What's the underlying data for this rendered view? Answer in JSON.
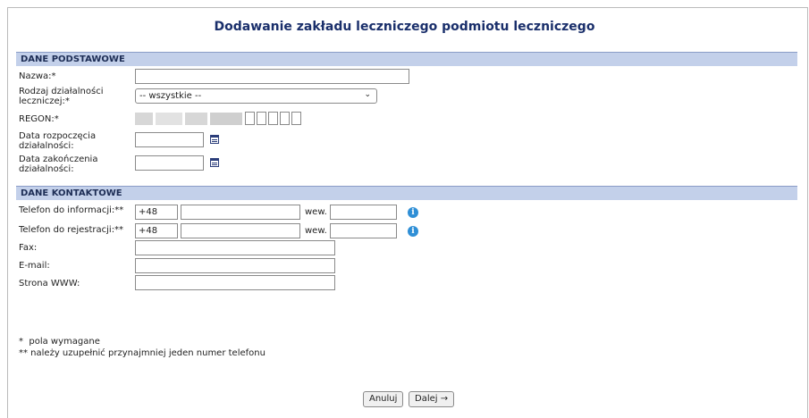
{
  "page": {
    "title": "Dodawanie zakładu leczniczego podmiotu leczniczego"
  },
  "sections": {
    "basic": "DANE PODSTAWOWE",
    "contact": "DANE KONTAKTOWE"
  },
  "basic": {
    "name_label": "Nazwa:*",
    "name_value": "",
    "activity_label_l1": "Rodzaj działalności",
    "activity_label_l2": "leczniczej:*",
    "activity_value": "-- wszystkie --",
    "regon_label": "REGON:*",
    "start_label_l1": "Data rozpoczęcia",
    "start_label_l2": "działalności:",
    "start_value": "",
    "end_label_l1": "Data zakończenia",
    "end_label_l2": "działalności:",
    "end_value": ""
  },
  "contact": {
    "phone_info_label": "Telefon do informacji:**",
    "phone_info_prefix": "+48",
    "phone_info_number": "",
    "phone_info_ext": "",
    "phone_reg_label": "Telefon do rejestracji:**",
    "phone_reg_prefix": "+48",
    "phone_reg_number": "",
    "phone_reg_ext": "",
    "ext_label": "wew.",
    "fax_label": "Fax:",
    "fax_value": "",
    "email_label": "E-mail:",
    "email_value": "",
    "www_label": "Strona WWW:",
    "www_value": ""
  },
  "notes": {
    "required": "*  pola wymagane",
    "phone_required": "** należy uzupełnić przynajmniej jeden numer telefonu"
  },
  "buttons": {
    "cancel": "Anuluj",
    "next": "Dalej →"
  },
  "colors": {
    "title": "#1a2f6b",
    "section_bg": "#c3d0ea",
    "info_icon": "#2f8fd6"
  },
  "icons": {
    "calendar": "calendar-icon",
    "info": "info-icon",
    "chevron": "chevron-down-icon"
  }
}
